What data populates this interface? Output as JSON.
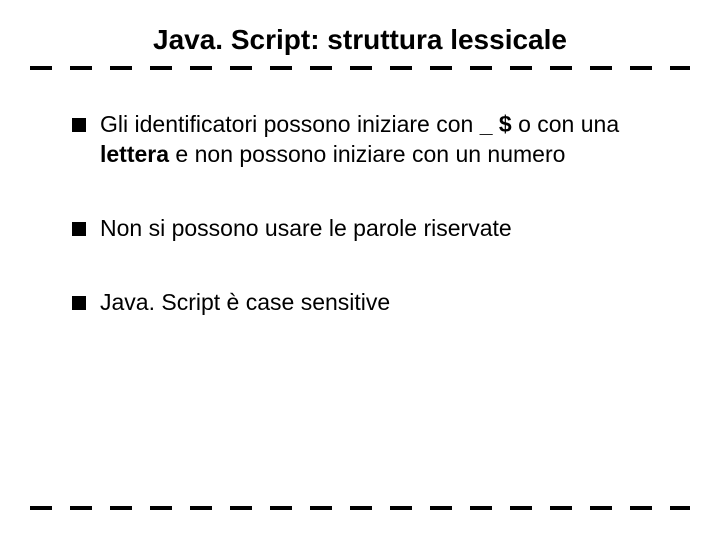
{
  "title": "Java. Script: struttura lessicale",
  "bullets": [
    {
      "pre": "Gli identificatori possono iniziare con ",
      "b1": "_",
      "mid1": "   ",
      "b2": "$",
      "mid2": " o con una ",
      "b3": "lettera",
      "post": " e non possono iniziare con un numero"
    },
    {
      "text": "Non si possono usare le parole riservate"
    },
    {
      "text": "Java. Script è case sensitive"
    }
  ]
}
